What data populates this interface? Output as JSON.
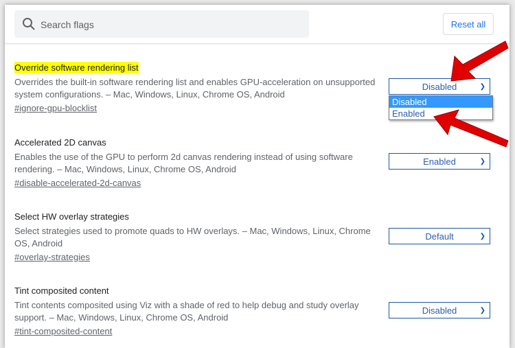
{
  "search": {
    "placeholder": "Search flags",
    "icon": "search-icon"
  },
  "reset_all_label": "Reset all",
  "flags": [
    {
      "title": "Override software rendering list",
      "highlighted": true,
      "description": "Overrides the built-in software rendering list and enables GPU-acceleration on unsupported system configurations. – Mac, Windows, Linux, Chrome OS, Android",
      "link": "#ignore-gpu-blocklist",
      "value": "Disabled"
    },
    {
      "title": "Accelerated 2D canvas",
      "description": "Enables the use of the GPU to perform 2d canvas rendering instead of using software rendering. – Mac, Windows, Linux, Chrome OS, Android",
      "link": "#disable-accelerated-2d-canvas",
      "value": "Enabled"
    },
    {
      "title": "Select HW overlay strategies",
      "description": "Select strategies used to promote quads to HW overlays. – Mac, Windows, Linux, Chrome OS, Android",
      "link": "#overlay-strategies",
      "value": "Default"
    },
    {
      "title": "Tint composited content",
      "description": "Tint contents composited using Viz with a shade of red to help debug and study overlay support. – Mac, Windows, Linux, Chrome OS, Android",
      "link": "#tint-composited-content",
      "value": "Disabled"
    }
  ],
  "dropdown_options": [
    "Disabled",
    "Enabled"
  ],
  "dropdown_selected": "Disabled",
  "colors": {
    "accent": "#1a73e8",
    "highlight": "#ffff00",
    "arrow": "#e00000",
    "option_selected": "#3399ff"
  }
}
